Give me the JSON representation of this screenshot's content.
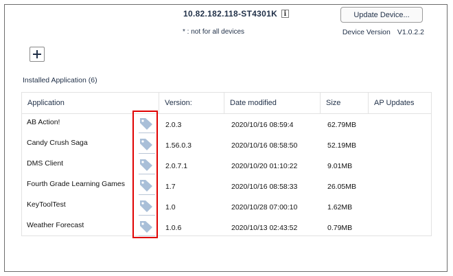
{
  "header": {
    "device_name": "10.82.182.118-ST4301K",
    "info_icon_glyph": "i",
    "note": "* : not for all devices",
    "update_button_label": "Update Device...",
    "device_version_label": "Device Version",
    "device_version_value": "V1.0.2.2"
  },
  "toolbar": {
    "add_icon": "plus-icon"
  },
  "section": {
    "title": "Installed Application (6)"
  },
  "table": {
    "columns": [
      "Application",
      "Version:",
      "Date modified",
      "Size",
      "AP Updates"
    ],
    "rows": [
      {
        "name": "AB Action!",
        "version": "2.0.3",
        "date": "2020/10/16 08:59:4",
        "size": "62.79MB"
      },
      {
        "name": "Candy Crush Saga",
        "version": "1.56.0.3",
        "date": "2020/10/16 08:58:50",
        "size": "52.19MB"
      },
      {
        "name": "DMS Client",
        "version": "2.0.7.1",
        "date": "2020/10/20 01:10:22",
        "size": "9.01MB"
      },
      {
        "name": "Fourth Grade Learning Games",
        "version": "1.7",
        "date": "2020/10/16 08:58:33",
        "size": "26.05MB"
      },
      {
        "name": "KeyToolTest",
        "version": "1.0",
        "date": "2020/10/28 07:00:10",
        "size": "1.62MB"
      },
      {
        "name": "Weather Forecast",
        "version": "1.0.6",
        "date": "2020/10/13 02:43:52",
        "size": "0.79MB"
      }
    ]
  },
  "colors": {
    "text": "#1f2f47",
    "tag_icon": "#a9bfd8",
    "highlight": "#e00000"
  }
}
